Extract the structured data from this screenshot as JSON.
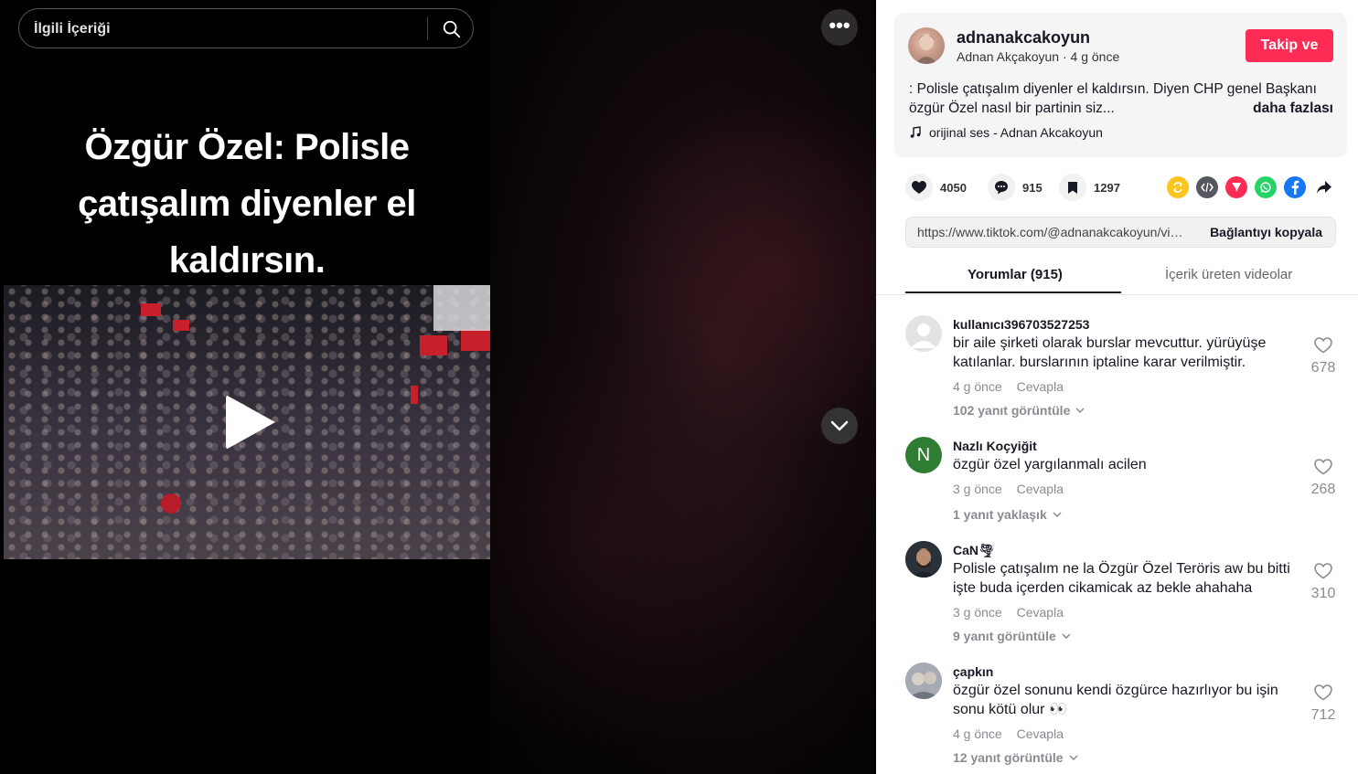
{
  "search": {
    "placeholder": "İlgili İçeriği"
  },
  "video": {
    "overlay_lines": [
      "Özgür Özel: Polisle",
      "çatışalım diyenler el",
      "kaldırsın."
    ]
  },
  "author": {
    "username": "adnanakcakoyun",
    "display_name": "Adnan Akçakoyun",
    "time": "4 g önce",
    "follow_label": "Takip ve"
  },
  "description": {
    "line1": ": Polisle çatışalım diyenler el kaldırsın. Diyen CHP genel Başkanı",
    "line2": "özgür Özel nasıl bir partinin siz...",
    "more_label": "daha fazlası"
  },
  "music": {
    "label": "orijinal ses - Adnan Akcakoyun"
  },
  "stats": {
    "likes": "4050",
    "comments": "915",
    "saves": "1297"
  },
  "share_icons": [
    {
      "name": "repost-icon",
      "color": "#fcc51e"
    },
    {
      "name": "embed-icon",
      "color": "#55575f"
    },
    {
      "name": "send-icon",
      "color": "#fe2c55"
    },
    {
      "name": "whatsapp-icon",
      "color": "#25d366"
    },
    {
      "name": "facebook-icon",
      "color": "#1877f2"
    },
    {
      "name": "share-arrow-icon",
      "color": "#161823"
    }
  ],
  "link": {
    "url": "https://www.tiktok.com/@adnanakcakoyun/video/74",
    "copy_label": "Bağlantıyı kopyala"
  },
  "tabs": [
    "Yorumlar (915)",
    "İçerik üreten videolar"
  ],
  "comments": [
    {
      "user": "kullanıcı396703527253",
      "lines": [
        "bir aile şirketi olarak burslar mevcuttur. yürüyüşe",
        "katılanlar. burslarının iptaline karar verilmiştir."
      ],
      "time": "4 g önce",
      "reply": "Cevapla",
      "likes": "678",
      "more": "102 yanıt görüntüle",
      "avatar": "default"
    },
    {
      "user": "Nazlı Koçyiğit",
      "lines": [
        "özgür özel yargılanmalı acilen"
      ],
      "time": "3 g önce",
      "reply": "Cevapla",
      "likes": "268",
      "more": "1 yanıt yaklaşık",
      "avatar": "N"
    },
    {
      "user": "CaN🌪",
      "lines": [
        "Polisle çatışalım ne la Özgür Özel Teröris aw bu bitti",
        "işte buda içerden cikamicak az bekle ahahaha"
      ],
      "time": "3 g önce",
      "reply": "Cevapla",
      "likes": "310",
      "more": "9 yanıt görüntüle",
      "avatar": "photo"
    },
    {
      "user": "çapkın",
      "lines": [
        "özgür özel sonunu kendi özgürce hazırlıyor bu işin",
        "sonu kötü olur 👀"
      ],
      "time": "4 g önce",
      "reply": "Cevapla",
      "likes": "712",
      "more": "12 yanıt görüntüle",
      "avatar": "photo2"
    }
  ]
}
